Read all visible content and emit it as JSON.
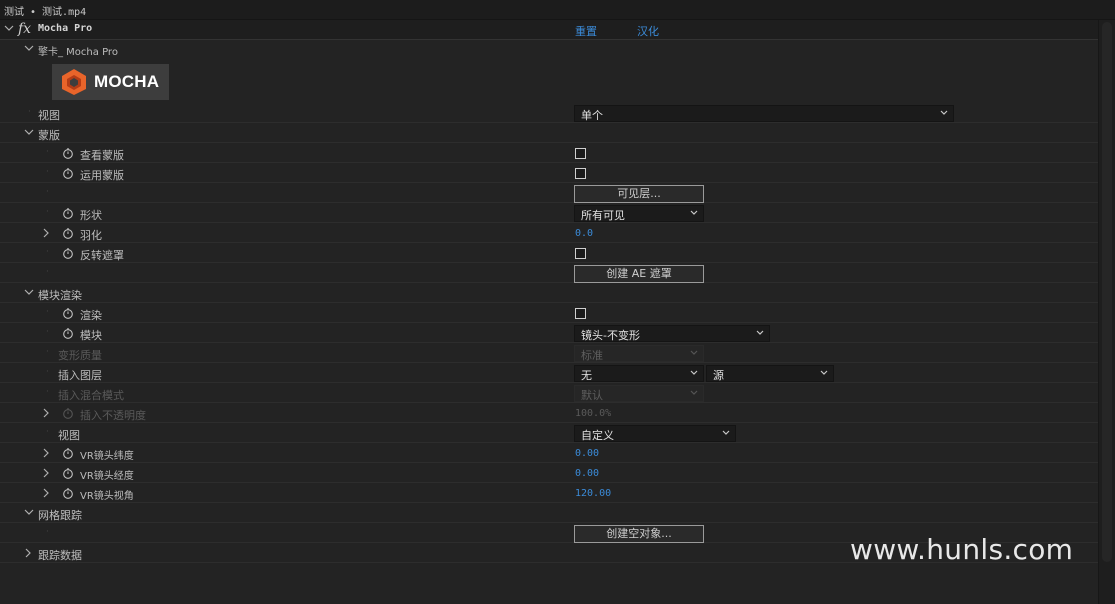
{
  "tab": {
    "title": "测试 • 测试.mp4"
  },
  "effect": {
    "name": "Mocha Pro",
    "reset_label": "重置",
    "localize_label": "汉化",
    "license_label": "擎卡_  Mocha Pro",
    "logo_text": "MOCHA"
  },
  "rows": {
    "view": {
      "label": "视图",
      "value": "单个"
    },
    "mattes": {
      "label": "蒙版"
    },
    "view_matte": {
      "label": "查看蒙版"
    },
    "apply_matte": {
      "label": "运用蒙版"
    },
    "visible_layers": {
      "button": "可见层..."
    },
    "shape": {
      "label": "形状",
      "value": "所有可见"
    },
    "feather": {
      "label": "羽化",
      "value": "0.0"
    },
    "invert_matte": {
      "label": "反转遮罩"
    },
    "create_ae_masks": {
      "button": "创建 AE 遮罩"
    },
    "module_render": {
      "label": "模块渲染"
    },
    "render": {
      "label": "渲染"
    },
    "module": {
      "label": "模块",
      "value": "镜头-不变形"
    },
    "warp_quality": {
      "label": "变形质量",
      "value": "标准"
    },
    "insert_layer": {
      "label": "插入图层",
      "value": "无",
      "value2": "源"
    },
    "insert_blend": {
      "label": "插入混合模式",
      "value": "默认"
    },
    "insert_opacity": {
      "label": "插入不透明度",
      "value": "100.0%"
    },
    "view2": {
      "label": "视图",
      "value": "自定义"
    },
    "vr_lat": {
      "label": "VR镜头纬度",
      "value": "0.00"
    },
    "vr_lon": {
      "label": "VR镜头经度",
      "value": "0.00"
    },
    "vr_fov": {
      "label": "VR镜头视角",
      "value": "120.00"
    },
    "mesh_tracking": {
      "label": "网格跟踪"
    },
    "create_null": {
      "button": "创建空对象..."
    },
    "tracking_data": {
      "label": "跟踪数据"
    }
  },
  "watermark": "www.hunls.com",
  "colors": {
    "accent": "#3b8bd8",
    "background": "#232323"
  }
}
